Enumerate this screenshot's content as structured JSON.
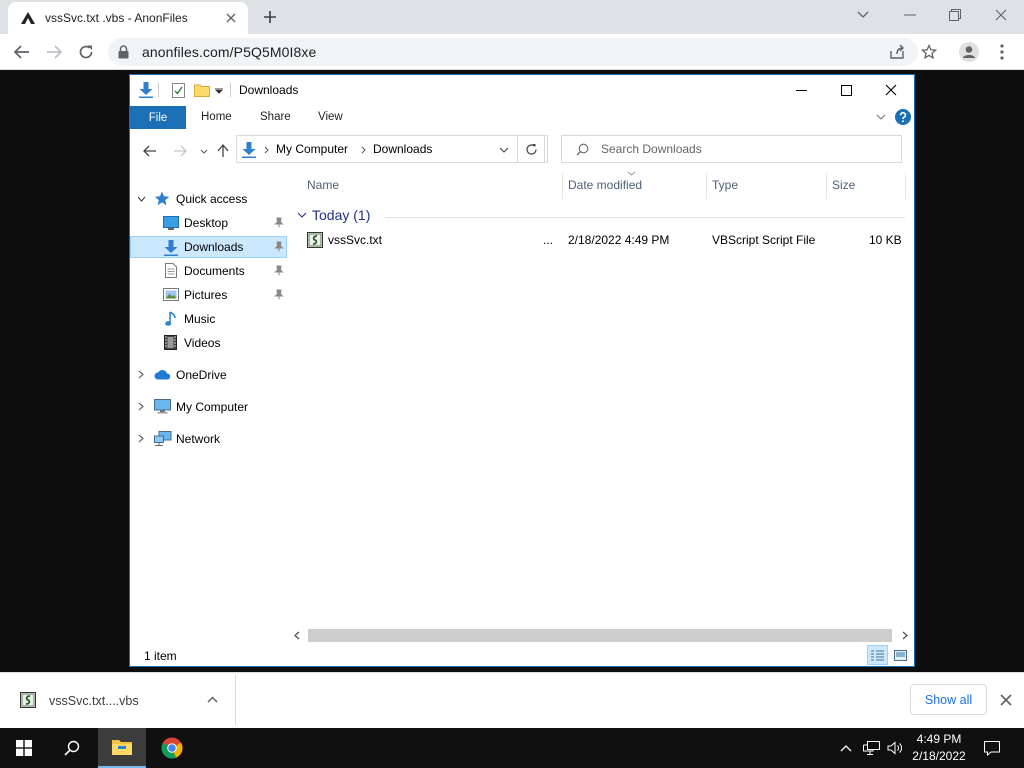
{
  "browser": {
    "tab_title": "vssSvc.txt .vbs - AnonFiles",
    "url": "anonfiles.com/P5Q5M0I8xe"
  },
  "explorer": {
    "title": "Downloads",
    "ribbon_tabs": {
      "file": "File",
      "home": "Home",
      "share": "Share",
      "view": "View"
    },
    "breadcrumb": [
      "My Computer",
      "Downloads"
    ],
    "search_placeholder": "Search Downloads",
    "nav": {
      "quick_access": "Quick access",
      "desktop": "Desktop",
      "downloads": "Downloads",
      "documents": "Documents",
      "pictures": "Pictures",
      "music": "Music",
      "videos": "Videos",
      "onedrive": "OneDrive",
      "my_computer": "My Computer",
      "network": "Network"
    },
    "columns": {
      "name": "Name",
      "date": "Date modified",
      "type": "Type",
      "size": "Size"
    },
    "group": "Today (1)",
    "files": [
      {
        "name": "vssSvc.txt",
        "ellipsis": "...",
        "date": "2/18/2022 4:49 PM",
        "type": "VBScript Script File",
        "size": "10 KB"
      }
    ],
    "status": "1 item"
  },
  "download_bar": {
    "item_name": "vssSvc.txt....vbs",
    "show_all": "Show all"
  },
  "taskbar": {
    "time": "4:49 PM",
    "date": "2/18/2022"
  },
  "colors": {
    "accent": "#1a6fb5",
    "selection": "#cce8ff",
    "link": "#1a73e8"
  }
}
